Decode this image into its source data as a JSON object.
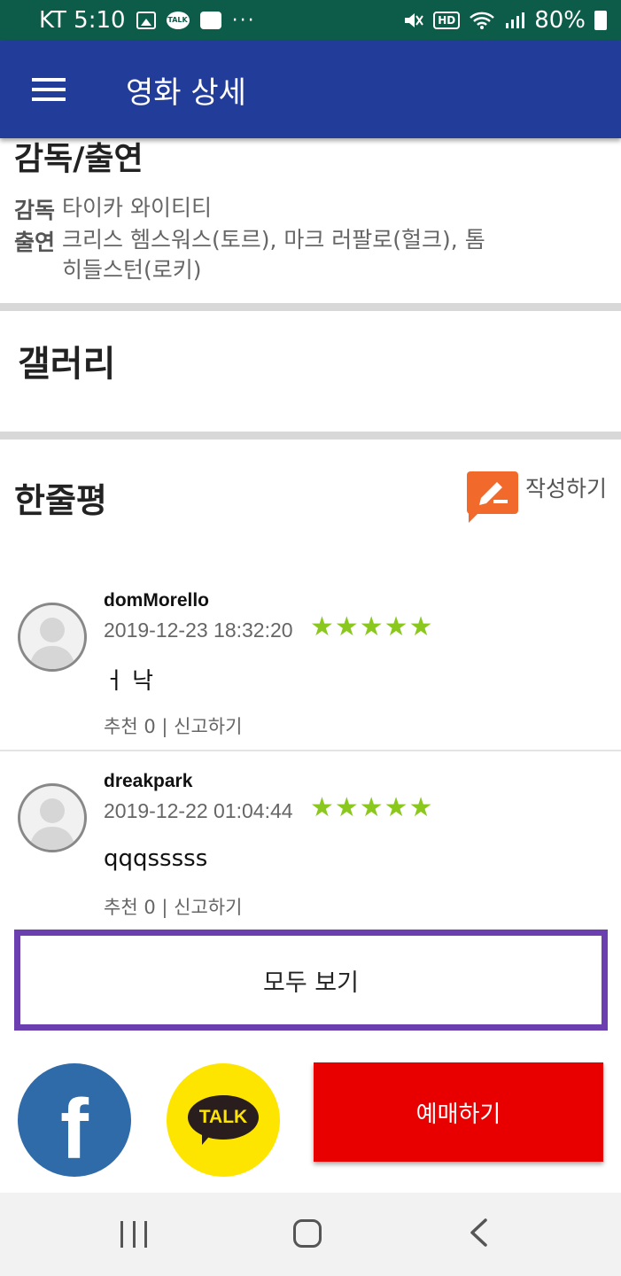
{
  "status_bar": {
    "carrier_time": "KT 5:10",
    "talk_badge": "TALK",
    "more": "···",
    "hd": "HD",
    "battery": "80%",
    "icons": [
      "image-icon",
      "kakaotalk-icon",
      "message-icon",
      "mute-icon",
      "wifi-icon",
      "signal-icon",
      "battery-icon"
    ]
  },
  "app_bar": {
    "title": "영화 상세",
    "menu_icon": "hamburger-icon"
  },
  "cast": {
    "title": "감독/출연",
    "director_label": "감독",
    "director": "타이카 와이티티",
    "actors_label": "출연",
    "actors": "크리스 헴스워스(토르), 마크 러팔로(헐크), 톰 히들스턴(로키)"
  },
  "gallery": {
    "title": "갤러리"
  },
  "reviews": {
    "title": "한줄평",
    "write_label": "작성하기",
    "items": [
      {
        "user": "domMorello",
        "date": "2019-12-23 18:32:20",
        "rating": 5,
        "stars": "★★★★★",
        "text": "ㅓ 낙",
        "recommend": "추천 0",
        "separator": "|",
        "report": "신고하기"
      },
      {
        "user": "dreakpark",
        "date": "2019-12-22 01:04:44",
        "rating": 5,
        "stars": "★★★★★",
        "text": "qqqsssss",
        "recommend": "추천 0",
        "separator": "|",
        "report": "신고하기"
      }
    ],
    "view_all": "모두 보기"
  },
  "share": {
    "facebook_icon": "facebook-icon",
    "facebook_glyph": "f",
    "kakao_icon": "kakaotalk-icon",
    "kakao_text": "TALK"
  },
  "booking": {
    "label": "예매하기"
  },
  "colors": {
    "status_bar": "#0d5c4a",
    "app_bar": "#223c9a",
    "star": "#8bc81e",
    "book_button": "#e80000",
    "view_all_border": "#6b3fb0",
    "write_icon": "#f26a2b",
    "facebook": "#2f6aa9",
    "kakao": "#fee500"
  }
}
